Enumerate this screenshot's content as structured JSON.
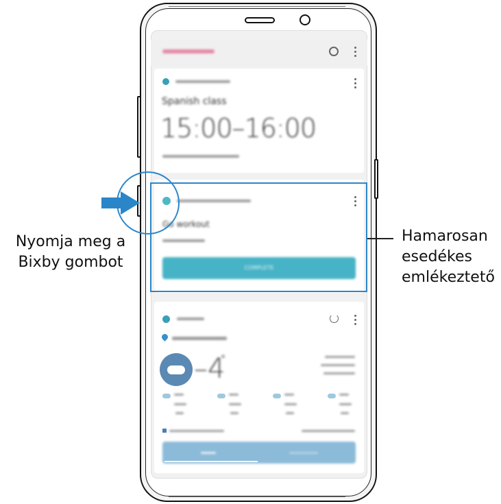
{
  "left_callout": {
    "line1": "Nyomja meg a",
    "line2": "Bixby gombot"
  },
  "right_callout": {
    "line1": "Hamarosan",
    "line2": "esedékes",
    "line3": "emlékeztető"
  },
  "screen": {
    "event_card": {
      "title": "Spanish class",
      "time": "15:00–16:00"
    },
    "reminder_card": {
      "title": "Go workout",
      "button_label": "COMPLETE"
    },
    "weather_card": {
      "temperature": "–4",
      "degree": "°"
    }
  },
  "colors": {
    "accent_blue": "#2a86c9",
    "app_teal": "#4fb8c4"
  },
  "icons": [
    "settings-icon",
    "more-options-icon",
    "calendar-icon",
    "reminder-icon",
    "weather-icon",
    "location-pin-icon",
    "refresh-icon",
    "cloud-icon",
    "arrow-right-icon"
  ]
}
